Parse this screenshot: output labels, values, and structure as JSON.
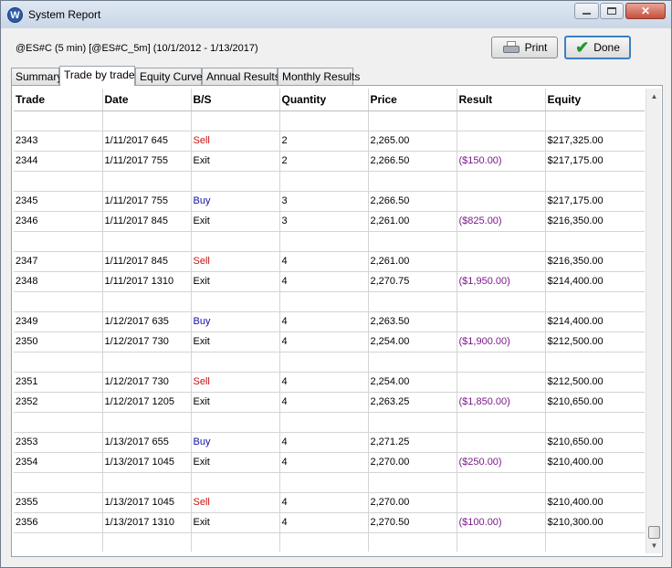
{
  "window": {
    "title": "System Report",
    "icon": "app-logo-w"
  },
  "header": {
    "info": "@ES#C (5 min) [@ES#C_5m]  (10/1/2012 - 1/13/2017)"
  },
  "buttons": {
    "print_label": "Print",
    "done_label": "Done"
  },
  "tabs": [
    {
      "label": "Summary"
    },
    {
      "label": "Trade by trade"
    },
    {
      "label": "Equity Curve"
    },
    {
      "label": "Annual Results"
    },
    {
      "label": "Monthly Results"
    }
  ],
  "active_tab": "Trade by trade",
  "table": {
    "columns": [
      "Trade",
      "Date",
      "B/S",
      "Quantity",
      "Price",
      "Result",
      "Equity"
    ],
    "rows": [
      [
        "",
        "",
        "",
        "",
        "",
        "",
        ""
      ],
      [
        "2343",
        "1/11/2017  645",
        "Sell",
        "2",
        "2,265.00",
        "",
        "$217,325.00"
      ],
      [
        "2344",
        "1/11/2017  755",
        "Exit",
        "2",
        "2,266.50",
        "($150.00)",
        "$217,175.00"
      ],
      [
        "",
        "",
        "",
        "",
        "",
        "",
        ""
      ],
      [
        "2345",
        "1/11/2017  755",
        "Buy",
        "3",
        "2,266.50",
        "",
        "$217,175.00"
      ],
      [
        "2346",
        "1/11/2017  845",
        "Exit",
        "3",
        "2,261.00",
        "($825.00)",
        "$216,350.00"
      ],
      [
        "",
        "",
        "",
        "",
        "",
        "",
        ""
      ],
      [
        "2347",
        "1/11/2017  845",
        "Sell",
        "4",
        "2,261.00",
        "",
        "$216,350.00"
      ],
      [
        "2348",
        "1/11/2017  1310",
        "Exit",
        "4",
        "2,270.75",
        "($1,950.00)",
        "$214,400.00"
      ],
      [
        "",
        "",
        "",
        "",
        "",
        "",
        ""
      ],
      [
        "2349",
        "1/12/2017  635",
        "Buy",
        "4",
        "2,263.50",
        "",
        "$214,400.00"
      ],
      [
        "2350",
        "1/12/2017  730",
        "Exit",
        "4",
        "2,254.00",
        "($1,900.00)",
        "$212,500.00"
      ],
      [
        "",
        "",
        "",
        "",
        "",
        "",
        ""
      ],
      [
        "2351",
        "1/12/2017  730",
        "Sell",
        "4",
        "2,254.00",
        "",
        "$212,500.00"
      ],
      [
        "2352",
        "1/12/2017  1205",
        "Exit",
        "4",
        "2,263.25",
        "($1,850.00)",
        "$210,650.00"
      ],
      [
        "",
        "",
        "",
        "",
        "",
        "",
        ""
      ],
      [
        "2353",
        "1/13/2017  655",
        "Buy",
        "4",
        "2,271.25",
        "",
        "$210,650.00"
      ],
      [
        "2354",
        "1/13/2017  1045",
        "Exit",
        "4",
        "2,270.00",
        "($250.00)",
        "$210,400.00"
      ],
      [
        "",
        "",
        "",
        "",
        "",
        "",
        ""
      ],
      [
        "2355",
        "1/13/2017  1045",
        "Sell",
        "4",
        "2,270.00",
        "",
        "$210,400.00"
      ],
      [
        "2356",
        "1/13/2017  1310",
        "Exit",
        "4",
        "2,270.50",
        "($100.00)",
        "$210,300.00"
      ],
      [
        "",
        "",
        "",
        "",
        "",
        "",
        ""
      ]
    ]
  },
  "colors": {
    "sell": "#cc1111",
    "buy": "#1111aa",
    "result": "#7a1a8a"
  }
}
